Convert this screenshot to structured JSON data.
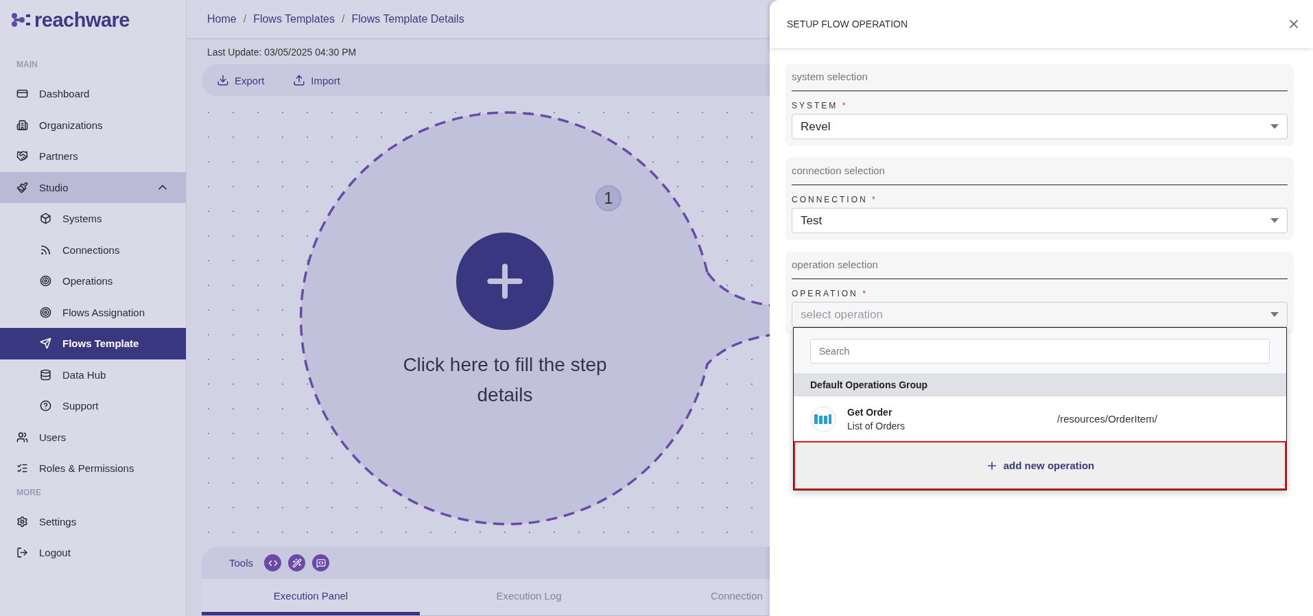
{
  "logo": {
    "text": "reachware"
  },
  "sidebar": {
    "sections": [
      {
        "heading": "MAIN",
        "items": [
          {
            "label": "Dashboard",
            "selected": false
          },
          {
            "label": "Organizations",
            "selected": false
          },
          {
            "label": "Partners",
            "selected": false
          },
          {
            "label": "Studio",
            "selected": false,
            "expanded": true,
            "children": [
              {
                "label": "Systems",
                "selected": false
              },
              {
                "label": "Connections",
                "selected": false
              },
              {
                "label": "Operations",
                "selected": false
              },
              {
                "label": "Flows Assignation",
                "selected": false
              },
              {
                "label": "Flows Template",
                "selected": true
              },
              {
                "label": "Data Hub",
                "selected": false
              },
              {
                "label": "Support",
                "selected": false
              }
            ]
          },
          {
            "label": "Users",
            "selected": false
          },
          {
            "label": "Roles & Permissions",
            "selected": false
          }
        ]
      },
      {
        "heading": "MORE",
        "items": [
          {
            "label": "Settings",
            "selected": false
          },
          {
            "label": "Logout",
            "selected": false
          }
        ]
      }
    ]
  },
  "breadcrumb": {
    "separator": "/",
    "items": [
      "Home",
      "Flows Templates",
      "Flows Template Details"
    ]
  },
  "last_update": "Last Update: 03/05/2025 04:30 PM",
  "toolbar": [
    {
      "label": "Export",
      "kind": "export"
    },
    {
      "label": "Import",
      "kind": "import"
    }
  ],
  "node": {
    "badge": "1",
    "text": "Click here to fill the step details"
  },
  "bottom_panel": {
    "tools_label": "Tools",
    "tabs": [
      {
        "label": "Execution Panel",
        "selected": true
      },
      {
        "label": "Execution Log",
        "selected": false
      },
      {
        "label": "Connection",
        "selected": false
      }
    ]
  },
  "setup_panel": {
    "title": "SETUP FLOW OPERATION",
    "sections": [
      {
        "heading": "system selection",
        "label": "SYSTEM",
        "required_mark": "*",
        "value": "Revel"
      },
      {
        "heading": "connection selection",
        "label": "CONNECTION",
        "required_mark": "*",
        "value": "Test"
      },
      {
        "heading": "operation selection",
        "label": "OPERATION",
        "required_mark": "*",
        "placeholder": "select operation",
        "open": true
      }
    ],
    "dropdown": {
      "search": {
        "placeholder": "Search"
      },
      "group": "Default Operations Group",
      "items": [
        {
          "title": "Get Order",
          "subtitle": "List of Orders",
          "path": "/resources/OrderItem/"
        }
      ],
      "add_action": {
        "label": "add new operation",
        "highlighted": true
      }
    }
  }
}
